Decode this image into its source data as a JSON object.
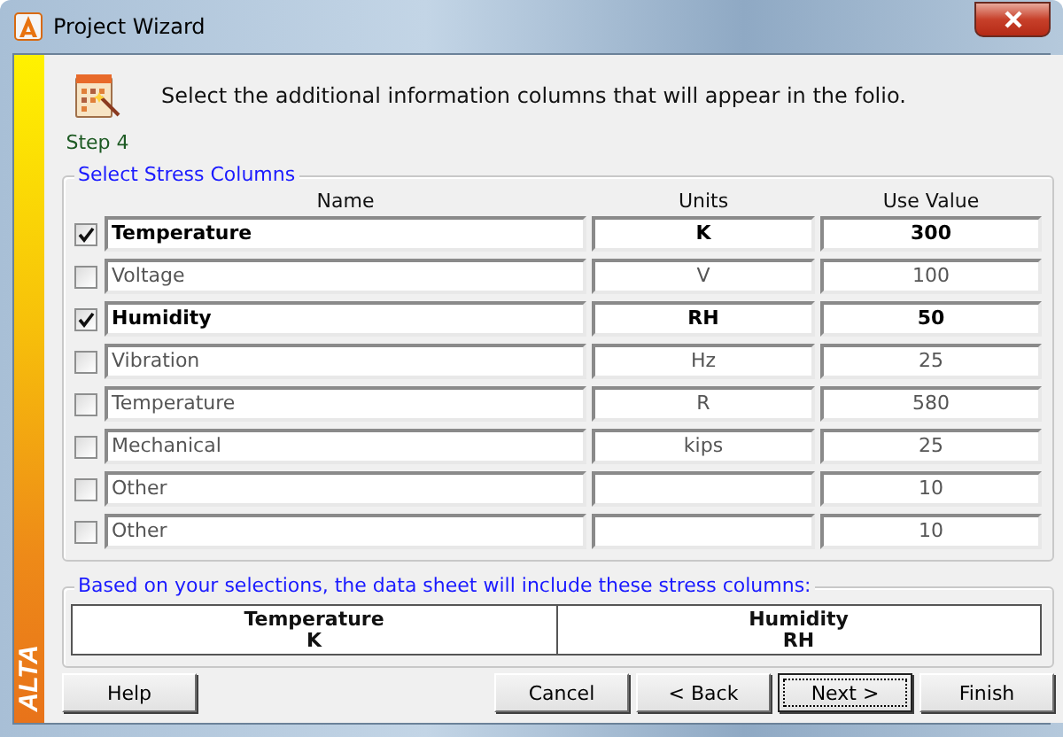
{
  "window": {
    "title": "Project Wizard"
  },
  "side_banner": {
    "label": "ALTA"
  },
  "step": {
    "label": "Step 4",
    "instruction": "Select the additional information columns that will appear in the folio."
  },
  "stress_columns": {
    "legend": "Select Stress Columns",
    "columns": [
      "Name",
      "Units",
      "Use Value"
    ],
    "rows": [
      {
        "checked": true,
        "name": "Temperature",
        "units": "K",
        "value": "300"
      },
      {
        "checked": false,
        "name": "Voltage",
        "units": "V",
        "value": "100"
      },
      {
        "checked": true,
        "name": "Humidity",
        "units": "RH",
        "value": "50"
      },
      {
        "checked": false,
        "name": "Vibration",
        "units": "Hz",
        "value": "25"
      },
      {
        "checked": false,
        "name": "Temperature",
        "units": "R",
        "value": "580"
      },
      {
        "checked": false,
        "name": "Mechanical",
        "units": "kips",
        "value": "25"
      },
      {
        "checked": false,
        "name": "Other",
        "units": "",
        "value": "10"
      },
      {
        "checked": false,
        "name": "Other",
        "units": "",
        "value": "10"
      }
    ]
  },
  "summary": {
    "legend": "Based on your selections, the data sheet will include these stress columns:",
    "columns": [
      {
        "name": "Temperature",
        "units": "K"
      },
      {
        "name": "Humidity",
        "units": "RH"
      }
    ]
  },
  "buttons": [
    {
      "label": "Help",
      "focused": false
    },
    {
      "label": "Cancel",
      "focused": false
    },
    {
      "label": "< Back",
      "focused": false
    },
    {
      "label": "Next >",
      "focused": true
    },
    {
      "label": "Finish",
      "focused": false
    }
  ]
}
